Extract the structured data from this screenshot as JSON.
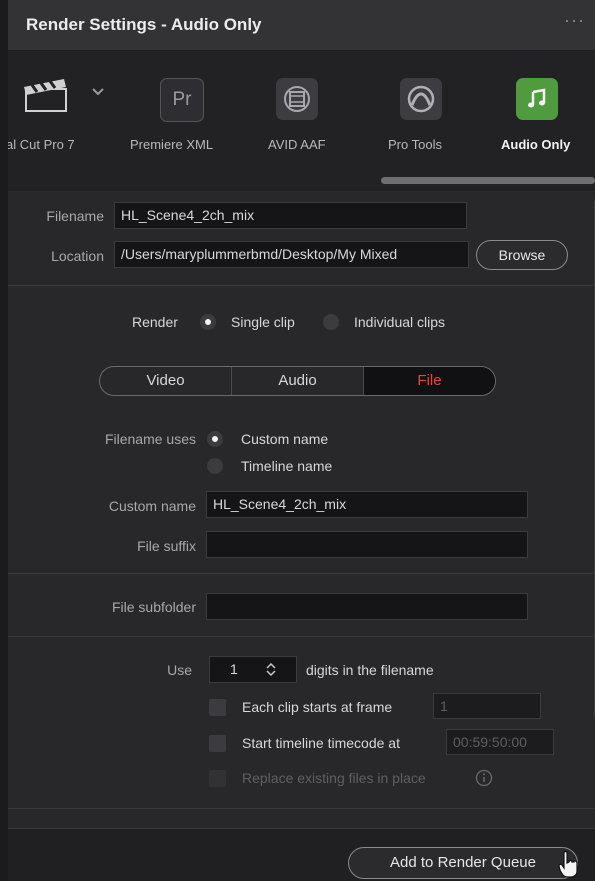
{
  "window": {
    "title": "Render Settings - Audio Only",
    "more_icon": "more-dots-icon"
  },
  "presets": [
    {
      "label": "al Cut Pro 7",
      "icon": "clapperboard-icon",
      "active": false
    },
    {
      "label": "Premiere XML",
      "icon": "premiere-pr-icon",
      "active": false
    },
    {
      "label": "AVID AAF",
      "icon": "film-reel-icon",
      "active": false
    },
    {
      "label": "Pro Tools",
      "icon": "pro-tools-icon",
      "active": false
    },
    {
      "label": "Audio Only",
      "icon": "music-note-icon",
      "active": true
    }
  ],
  "file_info": {
    "filename_label": "Filename",
    "filename_value": "HL_Scene4_2ch_mix",
    "location_label": "Location",
    "location_value": "/Users/maryplummerbmd/Desktop/My Mixed",
    "browse_label": "Browse"
  },
  "render_mode": {
    "label": "Render",
    "single_label": "Single clip",
    "individual_label": "Individual clips",
    "selected": "Single clip"
  },
  "tabs": [
    {
      "label": "Video",
      "active": false
    },
    {
      "label": "Audio",
      "active": false
    },
    {
      "label": "File",
      "active": true
    }
  ],
  "file_tab": {
    "filename_uses_label": "Filename uses",
    "custom_name_option": "Custom name",
    "timeline_name_option": "Timeline name",
    "selected": "Custom name",
    "custom_name_label": "Custom name",
    "custom_name_value": "HL_Scene4_2ch_mix",
    "file_suffix_label": "File suffix",
    "file_suffix_value": "",
    "file_subfolder_label": "File subfolder",
    "file_subfolder_value": "",
    "use_label": "Use",
    "digits_value": "1",
    "digits_suffix": "digits in the filename",
    "each_clip_label": "Each clip starts at frame",
    "each_clip_value": "1",
    "start_tc_label": "Start timeline timecode at",
    "start_tc_value": "00:59:50:00",
    "replace_label": "Replace existing files in place"
  },
  "footer": {
    "add_queue_label": "Add to Render Queue"
  },
  "colors": {
    "accent_green": "#4e9c3d",
    "active_tab_red": "#e5473a"
  }
}
